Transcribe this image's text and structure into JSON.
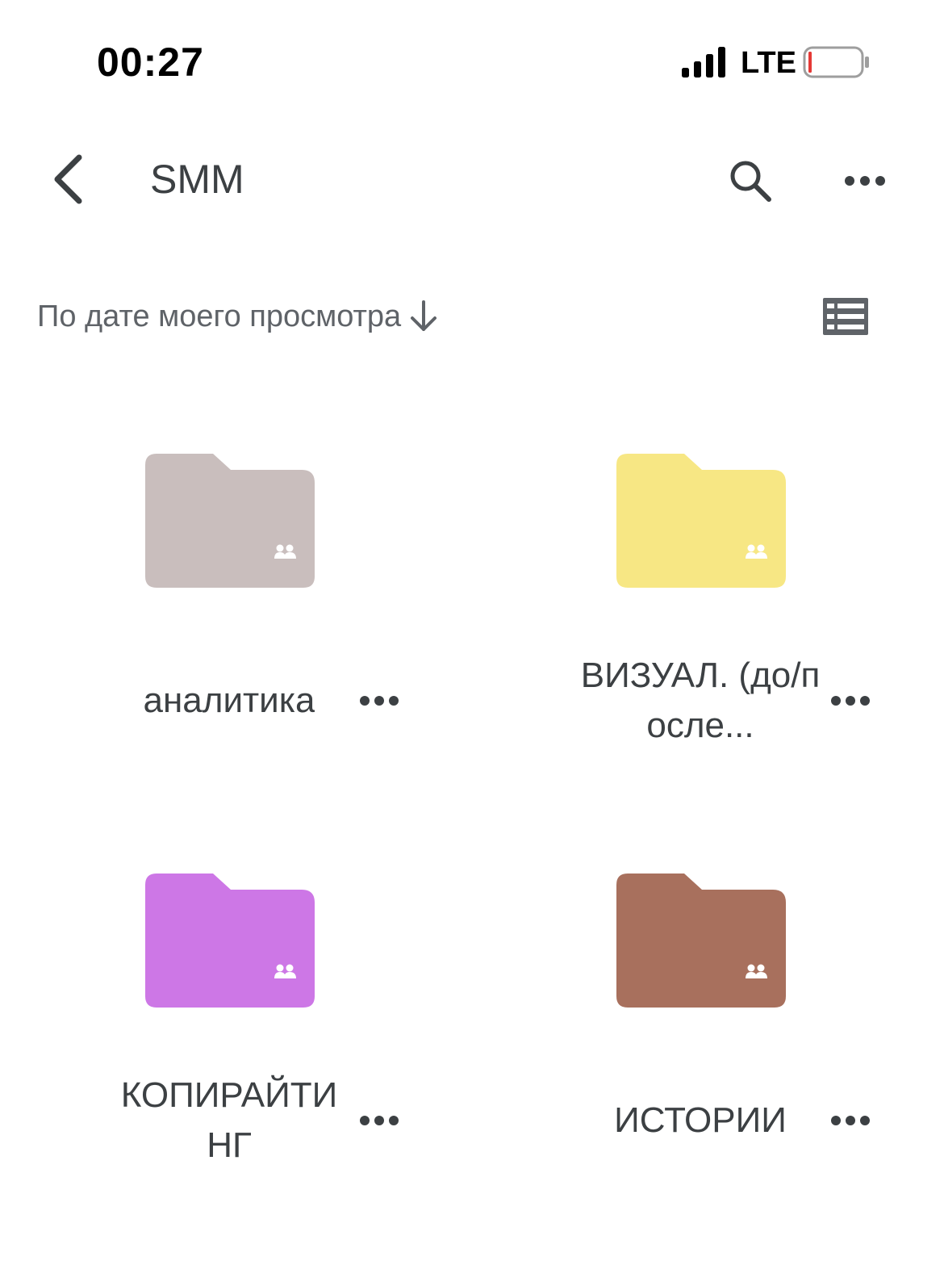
{
  "status_bar": {
    "time": "00:27",
    "network": "LTE"
  },
  "app_bar": {
    "title": "SMM",
    "icons": {
      "back": "chevron-left-icon",
      "search": "search-icon",
      "more": "more-horizontal-icon"
    }
  },
  "sort": {
    "label": "По дате моего просмотра",
    "direction_icon": "arrow-down-icon",
    "view_toggle_icon": "list-view-icon"
  },
  "folders": [
    {
      "name": "аналитика",
      "color": "#c9bebd",
      "shared": true
    },
    {
      "name": "ВИЗУАЛ. (до/после...",
      "color": "#f7e784",
      "shared": true
    },
    {
      "name": "КОПИРАЙТИНГ",
      "color": "#cd77e6",
      "shared": true
    },
    {
      "name": "ИСТОРИИ",
      "color": "#a8705d",
      "shared": true
    }
  ],
  "colors": {
    "text_primary": "#3c4043",
    "text_secondary": "#5f6368",
    "battery_low": "#e53935"
  }
}
